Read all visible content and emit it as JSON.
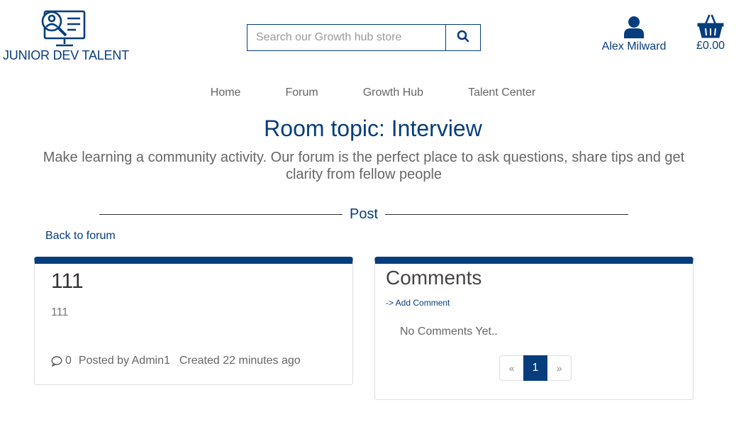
{
  "brand": {
    "name": "JUNIOR DEV TALENT",
    "color": "#063d7c",
    "logo_icon": "monitor-magnifier-icon"
  },
  "search": {
    "placeholder": "Search our Growth hub store",
    "value": "",
    "button_icon": "search-icon"
  },
  "account": {
    "name": "Alex Milward",
    "icon": "user-icon"
  },
  "cart": {
    "total": "£0.00",
    "icon": "basket-icon"
  },
  "nav": {
    "items": [
      {
        "label": "Home"
      },
      {
        "label": "Forum"
      },
      {
        "label": "Growth Hub"
      },
      {
        "label": "Talent Center"
      }
    ]
  },
  "page": {
    "title": "Room topic: Interview",
    "intro": "Make learning a community activity. Our forum is the perfect place to ask questions, share tips and get clarity from fellow people",
    "section_label": "Post",
    "back_link": "Back to forum"
  },
  "post": {
    "title": "111",
    "body": "111",
    "comment_count": "0",
    "posted_by": "Posted by Admin1",
    "created": "Created 22 minutes ago",
    "comment_icon": "speech-bubble-icon"
  },
  "comments": {
    "heading": "Comments",
    "add_link": "-> Add Comment",
    "empty_text": "No Comments Yet..",
    "pagination": {
      "prev": "«",
      "current": "1",
      "next": "»"
    }
  }
}
